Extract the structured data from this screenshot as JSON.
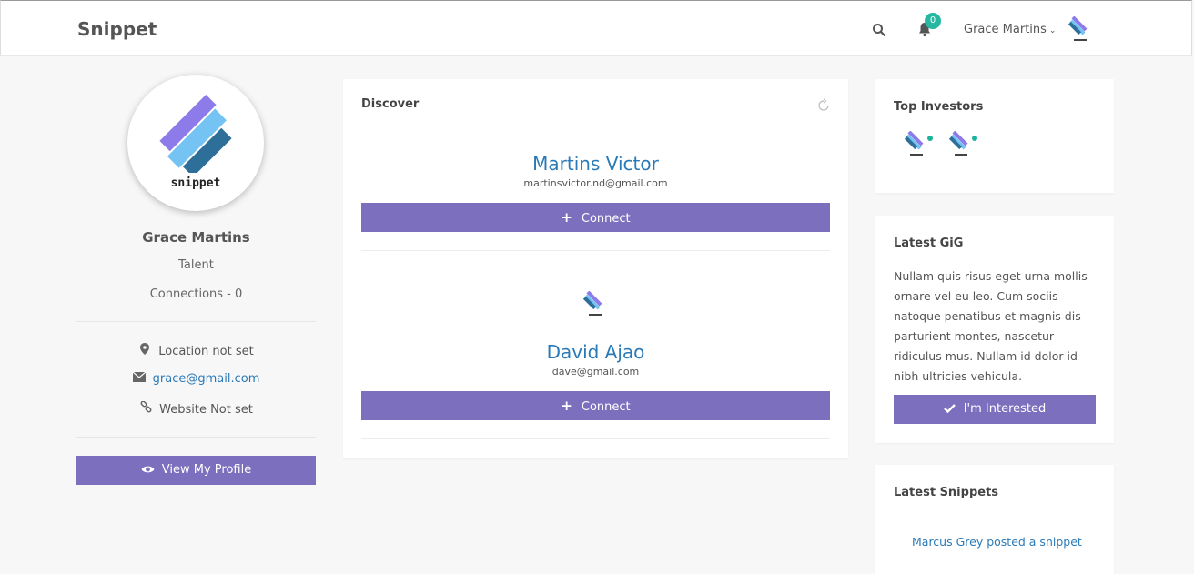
{
  "header": {
    "brand": "Snippet",
    "notifications_count": "0",
    "user_name": "Grace Martins",
    "caret": "⌄"
  },
  "profile": {
    "logo_word": "snippet",
    "name": "Grace Martins",
    "role": "Talent",
    "connections": "Connections - 0",
    "location": "Location not set",
    "email": "grace@gmail.com",
    "website": "Website Not set",
    "view_profile_label": "View My Profile"
  },
  "discover": {
    "title": "Discover",
    "people": [
      {
        "name": "Martins Victor",
        "email": "martinsvictor.nd@gmail.com",
        "connect_label": "Connect"
      },
      {
        "name": "David Ajao",
        "email": "dave@gmail.com",
        "connect_label": "Connect"
      }
    ]
  },
  "investors": {
    "title": "Top Investors"
  },
  "gig": {
    "title": "Latest GiG",
    "text": "Nullam quis risus eget urna mollis ornare vel eu leo. Cum sociis natoque penatibus et magnis dis parturient montes, nascetur ridiculus mus. Nullam id dolor id nibh ultricies vehicula.",
    "button_label": "I'm Interested"
  },
  "snippets": {
    "title": "Latest Snippets",
    "items": [
      "Marcus Grey posted a snippet"
    ]
  },
  "colors": {
    "accent": "#7c6fbd",
    "link": "#2a7ab8",
    "badge": "#26b8a0"
  }
}
